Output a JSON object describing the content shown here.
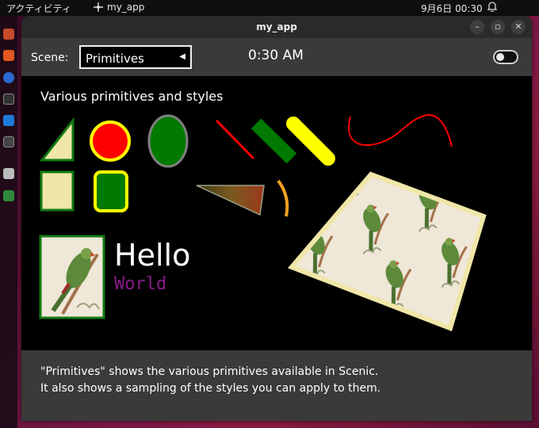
{
  "topbar": {
    "activities": "アクティビティ",
    "app_name": "my_app",
    "clock": "9月6日  00:30"
  },
  "window": {
    "title": "my_app"
  },
  "scene_bar": {
    "label": "Scene:",
    "selected": "Primitives",
    "time": "0:30 AM"
  },
  "canvas": {
    "heading": "Various primitives and styles",
    "hello": "Hello",
    "world": "World"
  },
  "footer": {
    "line1": "\"Primitives\" shows the various primitives available in Scenic.",
    "line2": "It also shows a sampling of the styles you can apply to them."
  },
  "colors": {
    "fill_beige": "#f0e6a8",
    "stroke_green": "#127a12",
    "red": "#ff0000",
    "yellow": "#ffff00",
    "green": "#007a00",
    "orange": "#f0a020",
    "purple_text": "#8a1a8a"
  }
}
